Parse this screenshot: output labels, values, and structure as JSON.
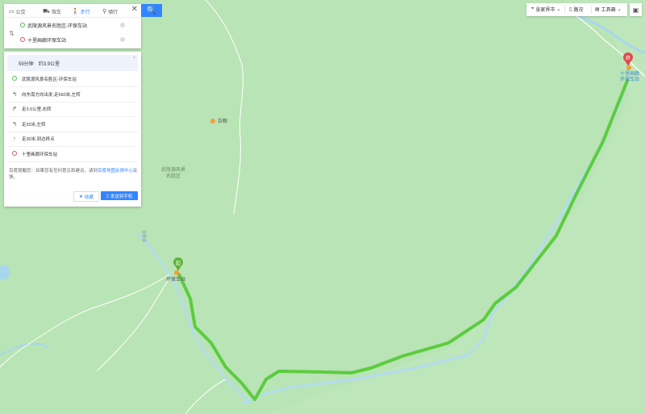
{
  "modes": [
    {
      "label": "公交",
      "icon": "bus-icon"
    },
    {
      "label": "驾车",
      "icon": "car-icon"
    },
    {
      "label": "步行",
      "icon": "walk-icon",
      "active": true
    },
    {
      "label": "骑行",
      "icon": "bike-icon"
    }
  ],
  "route": {
    "start": "武陵源风景名胜区-环保车站",
    "end": "十里画廊环保车站"
  },
  "summary": {
    "duration": "59分钟",
    "distance": "约3.9公里"
  },
  "steps": [
    {
      "icon": "start-dot-icon",
      "text": "武陵源风景名胜区-环保车站"
    },
    {
      "icon": "turn-left-icon",
      "text": "向东南方向出发,走660米,左转"
    },
    {
      "icon": "turn-right-icon",
      "text": "走3.0公里,右转"
    },
    {
      "icon": "turn-left-icon",
      "text": "走20米,左转"
    },
    {
      "icon": "straight-icon",
      "text": "走30米,到达终点"
    },
    {
      "icon": "end-dot-icon",
      "text": "十里画廊环保车站"
    }
  ],
  "note": {
    "text": "百度提醒您：如果您有任何意见和建议，请到",
    "link": "百度地图反馈中心",
    "tail": "反馈。"
  },
  "buttons": {
    "favorite": "收藏",
    "send": "发送到手机"
  },
  "toolbar": {
    "city": "张家界市",
    "city_arrow": "⌄",
    "traffic": "路况",
    "tools": "工具箱",
    "tools_arrow": "⌄"
  },
  "map_labels": {
    "poi_top": "杂粮",
    "area_line1": "武陵源风景",
    "area_line2": "名胜区",
    "start_station": "环保车站",
    "end_line1": "十里画廊",
    "end_line2": "环保车站",
    "road_label": "金鞭溪",
    "start_marker": "起",
    "end_marker": "终"
  },
  "colors": {
    "map_bg": "#b8e3b5",
    "river": "#a9d6ef",
    "route": "#5ccc3f",
    "road": "#ffffff",
    "accent": "#3385ff"
  }
}
